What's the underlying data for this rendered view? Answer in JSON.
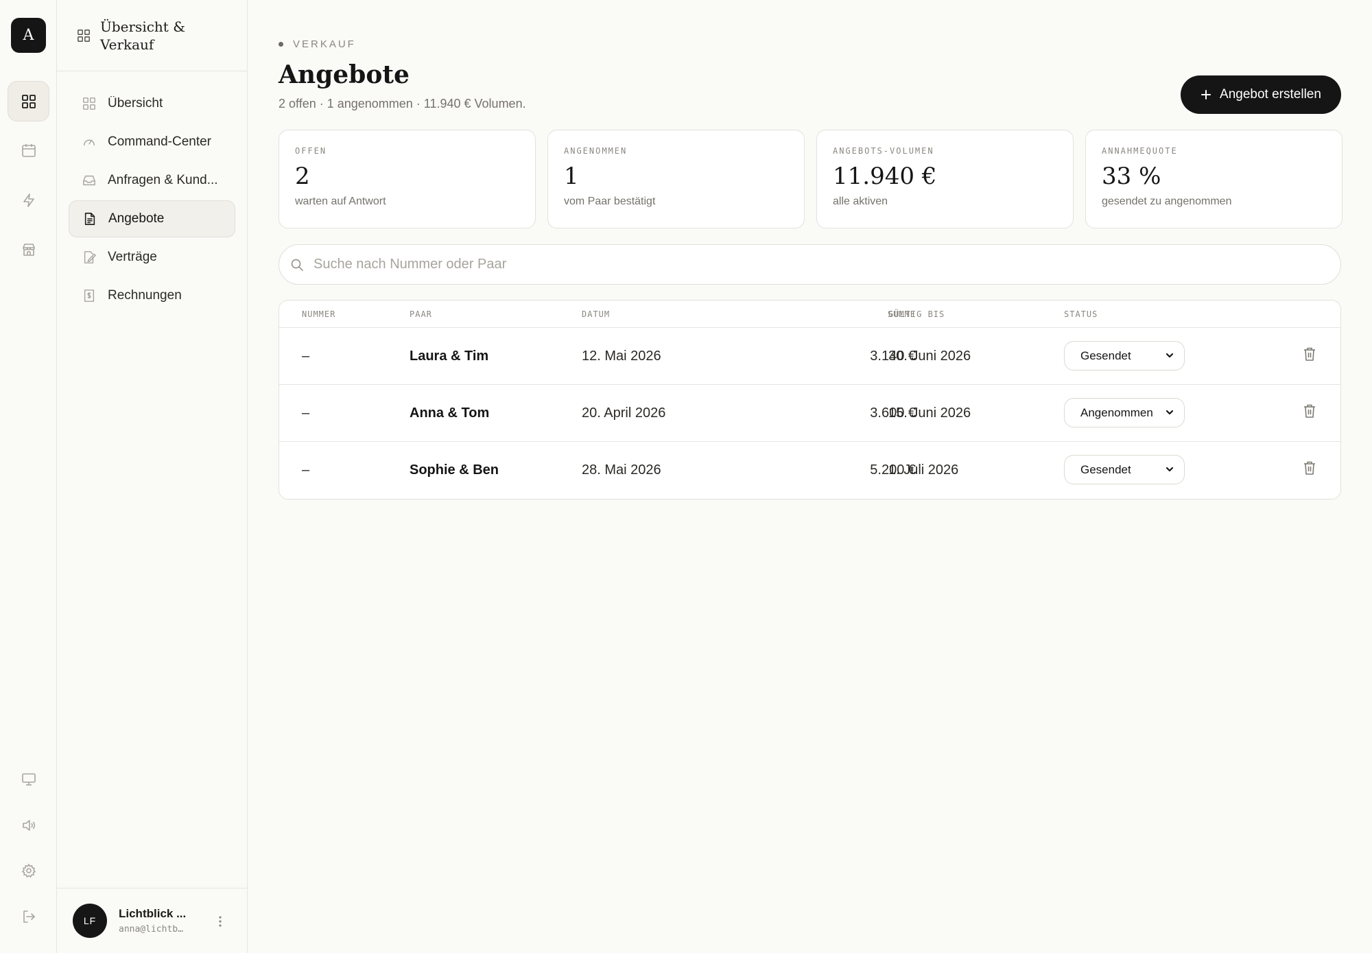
{
  "rail": {
    "logo_letter": "A",
    "icons": [
      "grid-icon",
      "calendar-icon",
      "bolt-icon",
      "store-icon",
      "monitor-icon",
      "speaker-icon",
      "gear-icon",
      "logout-icon"
    ]
  },
  "sidebar": {
    "title": "Übersicht & Verkauf",
    "items": [
      {
        "label": "Übersicht",
        "icon": "grid-icon"
      },
      {
        "label": "Command-Center",
        "icon": "gauge-icon"
      },
      {
        "label": "Anfragen & Kund...",
        "icon": "inbox-icon"
      },
      {
        "label": "Angebote",
        "icon": "document-icon",
        "active": true
      },
      {
        "label": "Verträge",
        "icon": "contract-icon"
      },
      {
        "label": "Rechnungen",
        "icon": "invoice-icon"
      }
    ],
    "user": {
      "initials": "LF",
      "name": "Lichtblick ...",
      "email": "anna@lichtb…"
    }
  },
  "header": {
    "eyebrow": "VERKAUF",
    "title": "Angebote",
    "subtitle": "2 offen · 1 angenommen · 11.940 € Volumen.",
    "create_label": "Angebot erstellen"
  },
  "stats": [
    {
      "label": "OFFEN",
      "value": "2",
      "sub": "warten auf Antwort"
    },
    {
      "label": "ANGENOMMEN",
      "value": "1",
      "sub": "vom Paar bestätigt"
    },
    {
      "label": "ANGEBOTS-VOLUMEN",
      "value": "11.940 €",
      "sub": "alle aktiven"
    },
    {
      "label": "ANNAHMEQUOTE",
      "value": "33 %",
      "sub": "gesendet zu angenommen"
    }
  ],
  "search": {
    "placeholder": "Suche nach Nummer oder Paar",
    "value": ""
  },
  "table": {
    "headers": [
      "NUMMER",
      "PAAR",
      "DATUM",
      "SUMME",
      "GÜLTIG BIS",
      "STATUS"
    ],
    "rows": [
      {
        "number": "–",
        "couple": "Laura & Tim",
        "date": "12. Mai 2026",
        "sum": "3.140 €",
        "valid_until": "30. Juni 2026",
        "status": "Gesendet"
      },
      {
        "number": "–",
        "couple": "Anna & Tom",
        "date": "20. April 2026",
        "sum": "3.600 €",
        "valid_until": "15. Juni 2026",
        "status": "Angenommen"
      },
      {
        "number": "–",
        "couple": "Sophie & Ben",
        "date": "28. Mai 2026",
        "sum": "5.200 €",
        "valid_until": "1. Juli 2026",
        "status": "Gesendet"
      }
    ]
  },
  "colors": {
    "background": "#fafaf7",
    "accent": "#151515",
    "border": "#e4e2dc",
    "muted_text": "#8a8780"
  }
}
